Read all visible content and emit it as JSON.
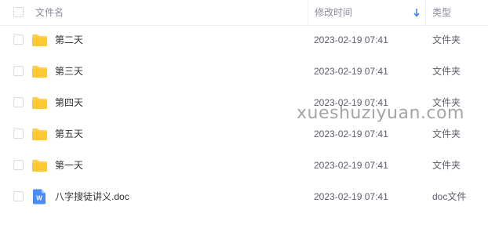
{
  "header": {
    "name_label": "文件名",
    "modified_label": "修改时间",
    "type_label": "类型",
    "sort_icon": "arrow-down-icon"
  },
  "files": [
    {
      "name": "第二天",
      "modified": "2023-02-19 07:41",
      "type": "文件夹",
      "icon": "folder-icon"
    },
    {
      "name": "第三天",
      "modified": "2023-02-19 07:41",
      "type": "文件夹",
      "icon": "folder-icon"
    },
    {
      "name": "第四天",
      "modified": "2023-02-19 07:41",
      "type": "文件夹",
      "icon": "folder-icon"
    },
    {
      "name": "第五天",
      "modified": "2023-02-19 07:41",
      "type": "文件夹",
      "icon": "folder-icon"
    },
    {
      "name": "第一天",
      "modified": "2023-02-19 07:41",
      "type": "文件夹",
      "icon": "folder-icon"
    },
    {
      "name": "八字搜徒讲义.doc",
      "modified": "2023-02-19 07:41",
      "type": "doc文件",
      "icon": "word-doc-icon"
    }
  ],
  "watermark": "xueshuziyuan.com",
  "colors": {
    "folder": "#FFD04B",
    "doc": "#4A8CF7",
    "sort_accent": "#2F7BEF"
  }
}
